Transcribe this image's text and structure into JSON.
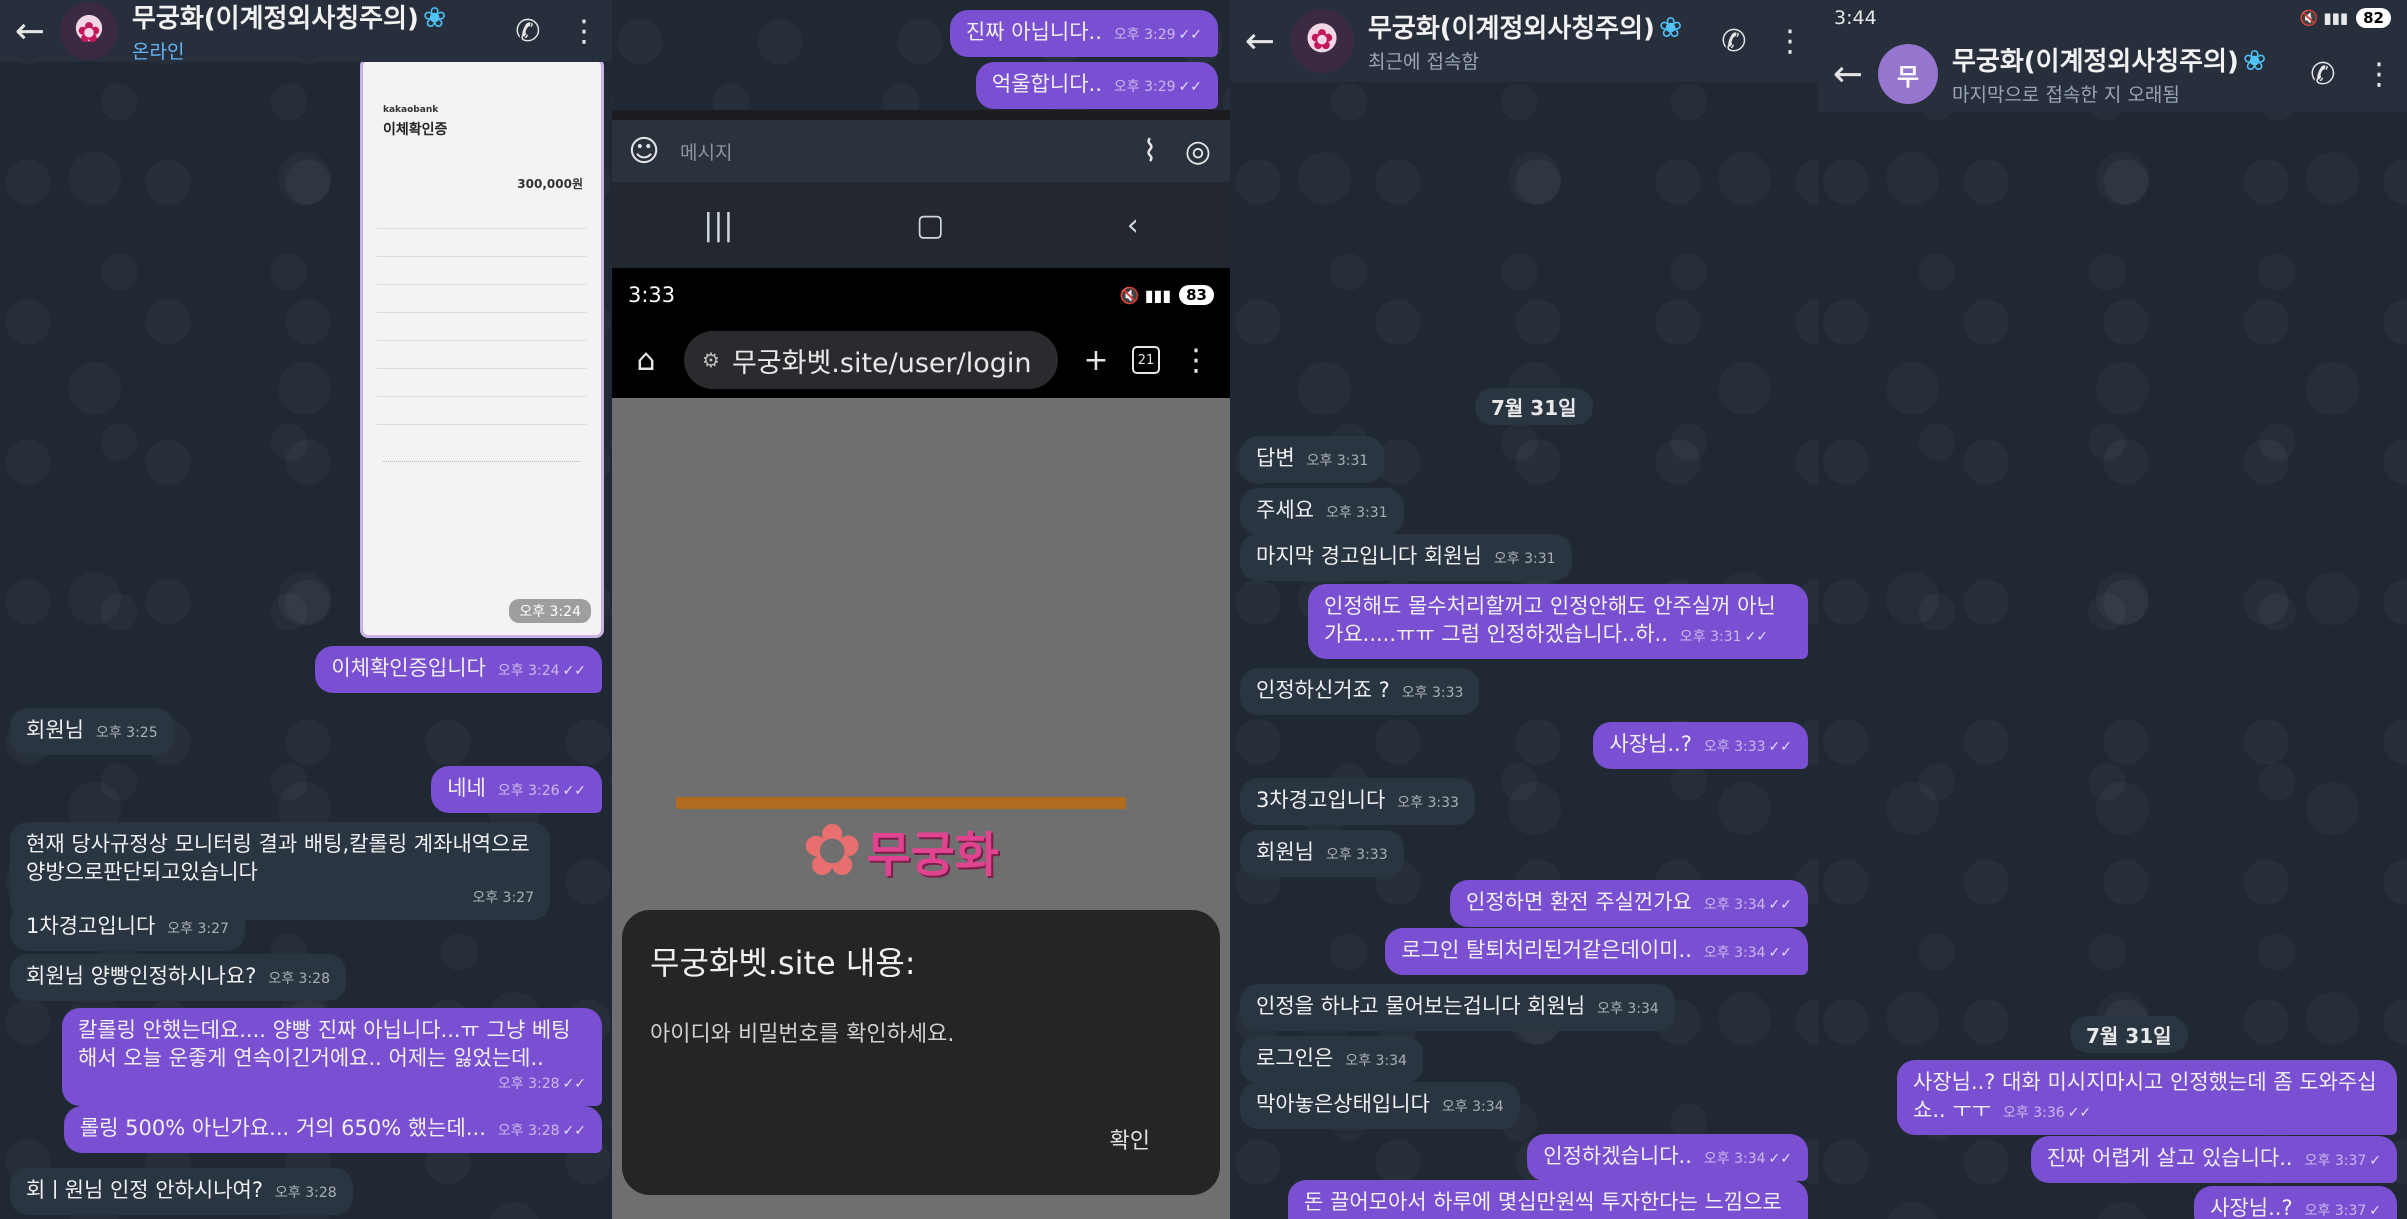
{
  "panel1": {
    "header": {
      "name": "무궁화(이계정외사칭주의)",
      "flower": "❀",
      "status": "온라인"
    },
    "receipt": {
      "bank": "kakaobank",
      "title": "이체확인증",
      "amount": "300,000원",
      "time": "오후 3:24"
    },
    "messages": [
      {
        "dir": "out",
        "text": "이체확인증입니다",
        "time": "오후 3:24"
      },
      {
        "dir": "in",
        "text": "회원님",
        "time": "오후 3:25"
      },
      {
        "dir": "out",
        "text": "네네",
        "time": "오후 3:26"
      },
      {
        "dir": "in",
        "text": "현재 당사규정상 모니터링 결과 배팅,칼롤링 계좌내역으로 양방으로판단되고있습니다",
        "time": "오후 3:27"
      },
      {
        "dir": "in",
        "text": "1차경고입니다",
        "time": "오후 3:27"
      },
      {
        "dir": "in",
        "text": "회원님 양빵인정하시나요?",
        "time": "오후 3:28"
      },
      {
        "dir": "out",
        "text": "칼롤링 안했는데요.... 양빵 진짜 아닙니다...ㅠ 그냥 베팅 해서 오늘 운좋게 연속이긴거에요.. 어제는 잃었는데..",
        "time": "오후 3:28"
      },
      {
        "dir": "out",
        "text": "롤링 500% 아닌가요... 거의 650% 했는데...",
        "time": "오후 3:28"
      },
      {
        "dir": "in",
        "text": "회ㅣ원님 인정 안하시나여?",
        "time": "오후 3:28"
      }
    ]
  },
  "panel2": {
    "messages": [
      {
        "dir": "out",
        "text": "진짜 아닙니다..",
        "time": "오후 3:29"
      },
      {
        "dir": "out",
        "text": "억울합니다..",
        "time": "오후 3:29"
      }
    ],
    "input_placeholder": "메시지",
    "statusbar": {
      "time": "3:33",
      "battery": "83"
    },
    "url": "무궁화벳.site/user/login",
    "tab_count": "21",
    "logo_text": "무궁화",
    "dialog": {
      "title": "무궁화벳.site 내용:",
      "message": "아이디와 비밀번호를 확인하세요.",
      "ok": "확인"
    }
  },
  "panel3": {
    "header": {
      "name": "무궁화(이계정외사칭주의)",
      "flower": "❀",
      "status": "최근에 접속함"
    },
    "date": "7월 31일",
    "messages": [
      {
        "dir": "in",
        "text": "답변",
        "time": "오후 3:31"
      },
      {
        "dir": "in",
        "text": "주세요",
        "time": "오후 3:31"
      },
      {
        "dir": "in",
        "text": "마지막 경고입니다 회원님",
        "time": "오후 3:31"
      },
      {
        "dir": "out",
        "text": "인정해도 몰수처리할꺼고 인정안해도 안주실꺼 아닌가요.....ㅠㅠ 그럼 인정하겠습니다..하..",
        "time": "오후 3:31"
      },
      {
        "dir": "in",
        "text": "인정하신거죠 ?",
        "time": "오후 3:33"
      },
      {
        "dir": "out",
        "text": "사장님..?",
        "time": "오후 3:33"
      },
      {
        "dir": "in",
        "text": "3차경고입니다",
        "time": "오후 3:33"
      },
      {
        "dir": "in",
        "text": "회원님",
        "time": "오후 3:33"
      },
      {
        "dir": "out",
        "text": "인정하면 환전 주실껀가요",
        "time": "오후 3:34"
      },
      {
        "dir": "out",
        "text": "로그인 탈퇴처리된거같은데이미..",
        "time": "오후 3:34"
      },
      {
        "dir": "in",
        "text": "인정을 하냐고 물어보는겁니다 회원님",
        "time": "오후 3:34"
      },
      {
        "dir": "in",
        "text": "로그인은",
        "time": "오후 3:34"
      },
      {
        "dir": "in",
        "text": "막아놓은상태입니다",
        "time": "오후 3:34"
      },
      {
        "dir": "out",
        "text": "인정하겠습니다..",
        "time": "오후 3:34"
      },
      {
        "dir": "out",
        "text": "돈 끌어모아서 하루에 몇십만원씩 투자한다는 느낌으로",
        "time": ""
      }
    ]
  },
  "panel4": {
    "statusbar": {
      "time": "3:44",
      "battery": "82"
    },
    "header": {
      "avatar_letter": "무",
      "name": "무궁화(이계정외사칭주의)",
      "flower": "❀",
      "status": "마지막으로 접속한 지 오래됨"
    },
    "date": "7월 31일",
    "messages": [
      {
        "dir": "out",
        "text": "사장님..? 대화 미시지마시고 인정했는데 좀 도와주십쇼.. ㅜㅜ",
        "time": "오후 3:36"
      },
      {
        "dir": "out",
        "text": "진짜 어렵게 살고 있습니다..",
        "time": "오후 3:37"
      },
      {
        "dir": "out",
        "text": "사장님..?",
        "time": "오후 3:37"
      }
    ]
  },
  "colors": {
    "outgoing": "#7a4fd1",
    "incoming": "#2a3542",
    "header": "#262f3b",
    "wallpaper": "#1f2833"
  }
}
